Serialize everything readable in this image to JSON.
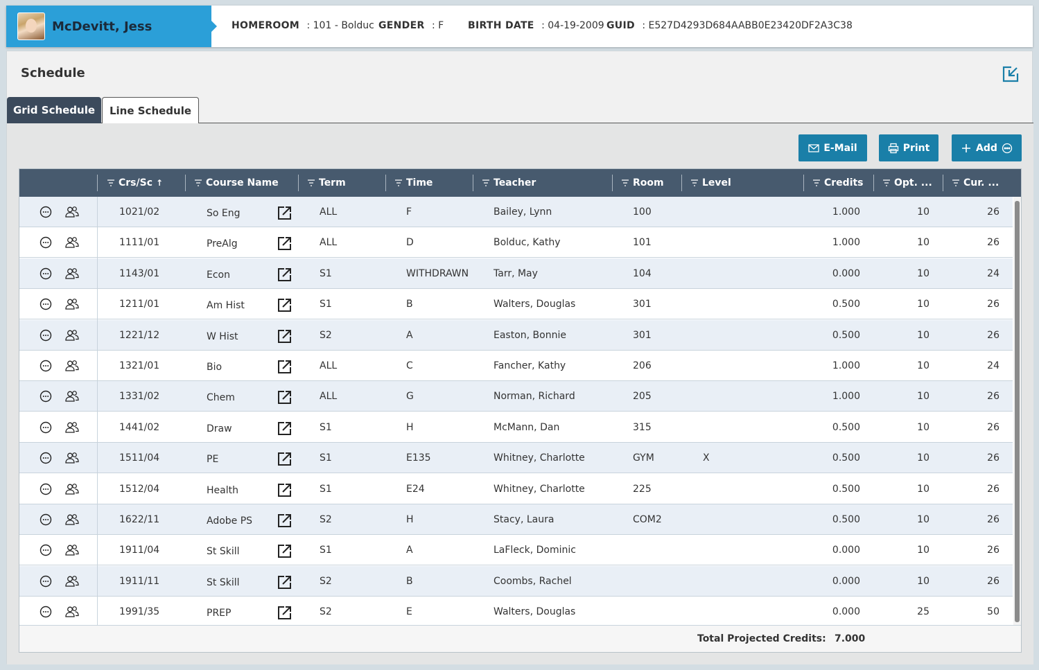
{
  "student": {
    "name": "McDevitt, Jess",
    "homeroom_label": "HOMEROOM",
    "homeroom_value": ": 101 - Bolduc",
    "gender_label": "GENDER",
    "gender_value": ": F",
    "birth_label": "BIRTH DATE",
    "birth_value": ": 04-19-2009",
    "guid_label": "GUID",
    "guid_value": ": E527D4293D684AABB0E23420DF2A3C38"
  },
  "panel": {
    "title": "Schedule"
  },
  "tabs": [
    {
      "label": "Grid Schedule",
      "active": false
    },
    {
      "label": "Line Schedule",
      "active": true
    }
  ],
  "toolbar": {
    "email_label": "E-Mail",
    "print_label": "Print",
    "add_label": "Add"
  },
  "columns": {
    "crs": "Crs/Sc",
    "course": "Course Name",
    "term": "Term",
    "time": "Time",
    "teacher": "Teacher",
    "room": "Room",
    "level": "Level",
    "credits": "Credits",
    "opt": "Opt. ...",
    "cur": "Cur. ..."
  },
  "rows": [
    {
      "crs": "1021/02",
      "course": "So Eng",
      "term": "ALL",
      "time": "F",
      "teacher": "Bailey, Lynn",
      "room": "100",
      "level": "",
      "credits": "1.000",
      "opt": "10",
      "cur": "26"
    },
    {
      "crs": "1111/01",
      "course": "PreAlg",
      "term": "ALL",
      "time": "D",
      "teacher": "Bolduc, Kathy",
      "room": "101",
      "level": "",
      "credits": "1.000",
      "opt": "10",
      "cur": "26"
    },
    {
      "crs": "1143/01",
      "course": "Econ",
      "term": "S1",
      "time": "WITHDRAWN",
      "teacher": "Tarr, May",
      "room": "104",
      "level": "",
      "credits": "0.000",
      "opt": "10",
      "cur": "24"
    },
    {
      "crs": "1211/01",
      "course": "Am Hist",
      "term": "S1",
      "time": "B",
      "teacher": "Walters, Douglas",
      "room": "301",
      "level": "",
      "credits": "0.500",
      "opt": "10",
      "cur": "26"
    },
    {
      "crs": "1221/12",
      "course": "W Hist",
      "term": "S2",
      "time": "A",
      "teacher": "Easton, Bonnie",
      "room": "301",
      "level": "",
      "credits": "0.500",
      "opt": "10",
      "cur": "26"
    },
    {
      "crs": "1321/01",
      "course": "Bio",
      "term": "ALL",
      "time": "C",
      "teacher": "Fancher, Kathy",
      "room": "206",
      "level": "",
      "credits": "1.000",
      "opt": "10",
      "cur": "24"
    },
    {
      "crs": "1331/02",
      "course": "Chem",
      "term": "ALL",
      "time": "G",
      "teacher": "Norman, Richard",
      "room": "205",
      "level": "",
      "credits": "1.000",
      "opt": "10",
      "cur": "26"
    },
    {
      "crs": "1441/02",
      "course": "Draw",
      "term": "S1",
      "time": "H",
      "teacher": "McMann, Dan",
      "room": "315",
      "level": "",
      "credits": "0.500",
      "opt": "10",
      "cur": "26"
    },
    {
      "crs": "1511/04",
      "course": "PE",
      "term": "S1",
      "time": "E135",
      "teacher": "Whitney, Charlotte",
      "room": "GYM",
      "level": "X",
      "credits": "0.500",
      "opt": "10",
      "cur": "26"
    },
    {
      "crs": "1512/04",
      "course": "Health",
      "term": "S1",
      "time": "E24",
      "teacher": "Whitney, Charlotte",
      "room": "225",
      "level": "",
      "credits": "0.500",
      "opt": "10",
      "cur": "26"
    },
    {
      "crs": "1622/11",
      "course": "Adobe PS",
      "term": "S2",
      "time": "H",
      "teacher": "Stacy, Laura",
      "room": "COM2",
      "level": "",
      "credits": "0.500",
      "opt": "10",
      "cur": "26"
    },
    {
      "crs": "1911/04",
      "course": "St Skill",
      "term": "S1",
      "time": "A",
      "teacher": "LaFleck, Dominic",
      "room": "",
      "level": "",
      "credits": "0.000",
      "opt": "10",
      "cur": "26"
    },
    {
      "crs": "1911/11",
      "course": "St Skill",
      "term": "S2",
      "time": "B",
      "teacher": "Coombs, Rachel",
      "room": "",
      "level": "",
      "credits": "0.000",
      "opt": "10",
      "cur": "26"
    },
    {
      "crs": "1991/35",
      "course": "PREP",
      "term": "S2",
      "time": "E",
      "teacher": "Walters, Douglas",
      "room": "",
      "level": "",
      "credits": "0.000",
      "opt": "25",
      "cur": "50"
    }
  ],
  "footer": {
    "total_label": "Total Projected Credits:",
    "total_value": "7.000"
  },
  "colors": {
    "header_blue": "#2b9fd8",
    "button_blue": "#1a7fa8",
    "grid_header": "#475a6e",
    "tab_dark": "#3b4a5c",
    "row_alt": "#e9eff6"
  }
}
